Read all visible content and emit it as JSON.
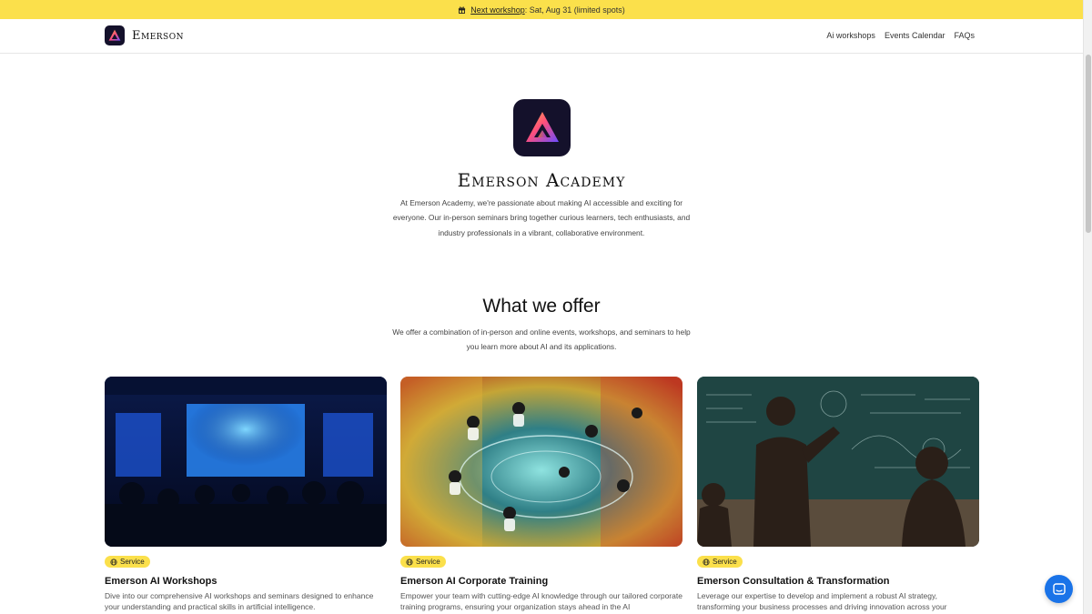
{
  "announcement": {
    "link_text": "Next workshop",
    "rest_text": ": Sat, Aug 31 (limited spots)"
  },
  "header": {
    "brand": "Emerson",
    "nav": [
      "Ai workshops",
      "Events Calendar",
      "FAQs"
    ]
  },
  "hero": {
    "title": "Emerson Academy",
    "description": "At Emerson Academy, we're passionate about making AI accessible and exciting for everyone. Our in-person seminars bring together curious learners, tech enthusiasts, and industry professionals in a vibrant, collaborative environment."
  },
  "offer": {
    "title": "What we offer",
    "description": "We offer a combination of in-person and online events, workshops, and seminars to help you learn more about AI and its applications."
  },
  "cards": [
    {
      "badge": "Service",
      "title": "Emerson AI Workshops",
      "description": "Dive into our comprehensive AI workshops and seminars designed to enhance your understanding and practical skills in artificial intelligence.",
      "image": "seminar-room-screens"
    },
    {
      "badge": "Service",
      "title": "Emerson AI Corporate Training",
      "description": "Empower your team with cutting-edge AI knowledge through our tailored corporate training programs, ensuring your organization stays ahead in the AI",
      "image": "colorful-team-circle"
    },
    {
      "badge": "Service",
      "title": "Emerson Consultation & Transformation",
      "description": "Leverage our expertise to develop and implement a robust AI strategy, transforming your business processes and driving innovation across your",
      "image": "teacher-chalkboard"
    }
  ],
  "colors": {
    "accent_yellow": "#fbe04b",
    "logo_bg": "#14112b",
    "chat_blue": "#1a73e8"
  },
  "icons": [
    "gift-icon",
    "brand-logo-icon",
    "globe-icon",
    "chat-icon"
  ]
}
